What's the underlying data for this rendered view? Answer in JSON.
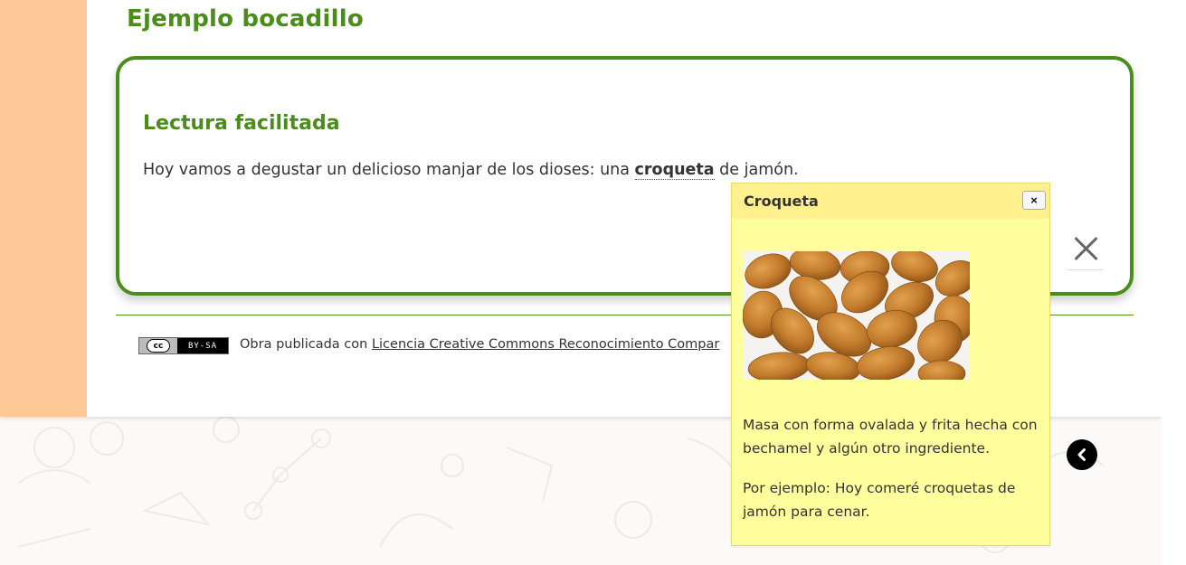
{
  "page": {
    "title": "Ejemplo bocadillo"
  },
  "card": {
    "heading": "Lectura facilitada",
    "text_before": "Hoy vamos a degustar un delicioso manjar de los dioses: una ",
    "term": "croqueta",
    "text_after": " de jamón."
  },
  "footer": {
    "cc_left": "cc",
    "cc_right": "BY-SA",
    "license_prefix": "Obra publicada con ",
    "license_link": "Licencia Creative Commons Reconocimiento Compar"
  },
  "popup": {
    "title": "Croqueta",
    "close_label": "×",
    "definition": "Masa con forma ovalada y frita hecha con bechamel y algún otro ingrediente.",
    "example": "Por ejemplo: Hoy comeré croquetas de jamón para cenar."
  },
  "colors": {
    "accent": "#4a8d1a",
    "left_band": "#ffc896",
    "popup_bg": "#ffff9e",
    "popup_header": "#fff08e"
  },
  "icons": {
    "close": "close-icon",
    "nav": "chevron-left-icon"
  }
}
